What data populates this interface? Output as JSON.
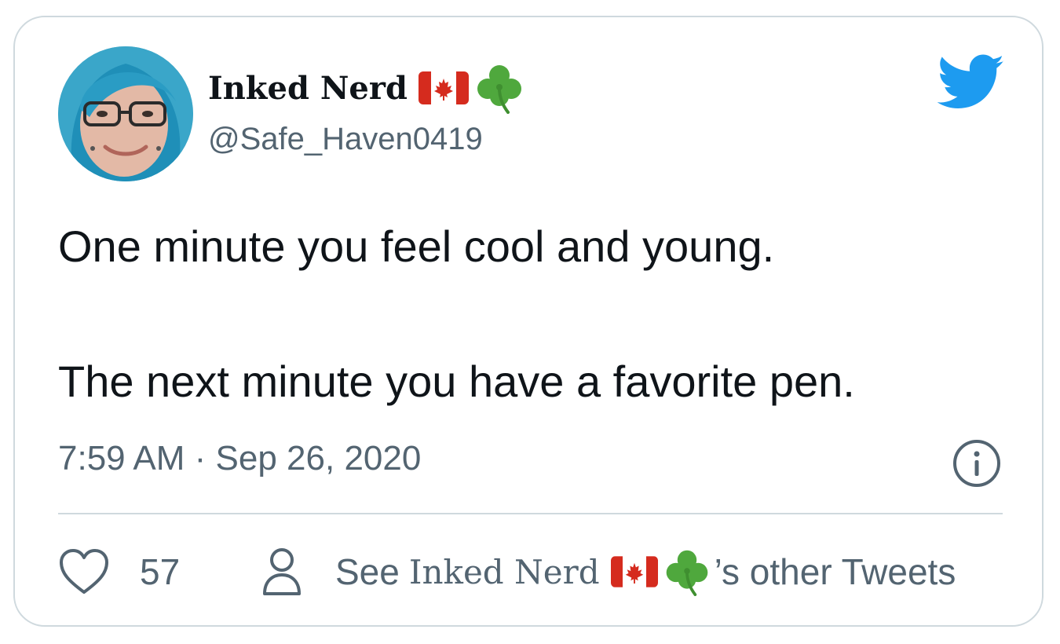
{
  "author": {
    "display_name": "Inked Nerd",
    "handle": "@Safe_Haven0419",
    "flag_emoji": "canada-flag",
    "clover_emoji": "shamrock"
  },
  "tweet": {
    "line1": "One minute you feel cool and young.",
    "line2": "The next minute you have a favorite pen.",
    "timestamp": "7:59 AM · Sep 26, 2020"
  },
  "actions": {
    "like_count": "57",
    "other_tweets_prefix": "See",
    "other_tweets_name": "Inked Nerd",
    "other_tweets_suffix": "’s other Tweets"
  },
  "icons": {
    "brand": "twitter-bird-icon",
    "info": "info-icon",
    "like": "heart-icon",
    "profile": "person-icon"
  },
  "colors": {
    "twitter_blue": "#1d9bf0",
    "text_primary": "#0f1419",
    "text_secondary": "#536471",
    "border": "#cfd9de",
    "flag_red": "#d52b1e",
    "clover_green": "#4fa83d"
  }
}
